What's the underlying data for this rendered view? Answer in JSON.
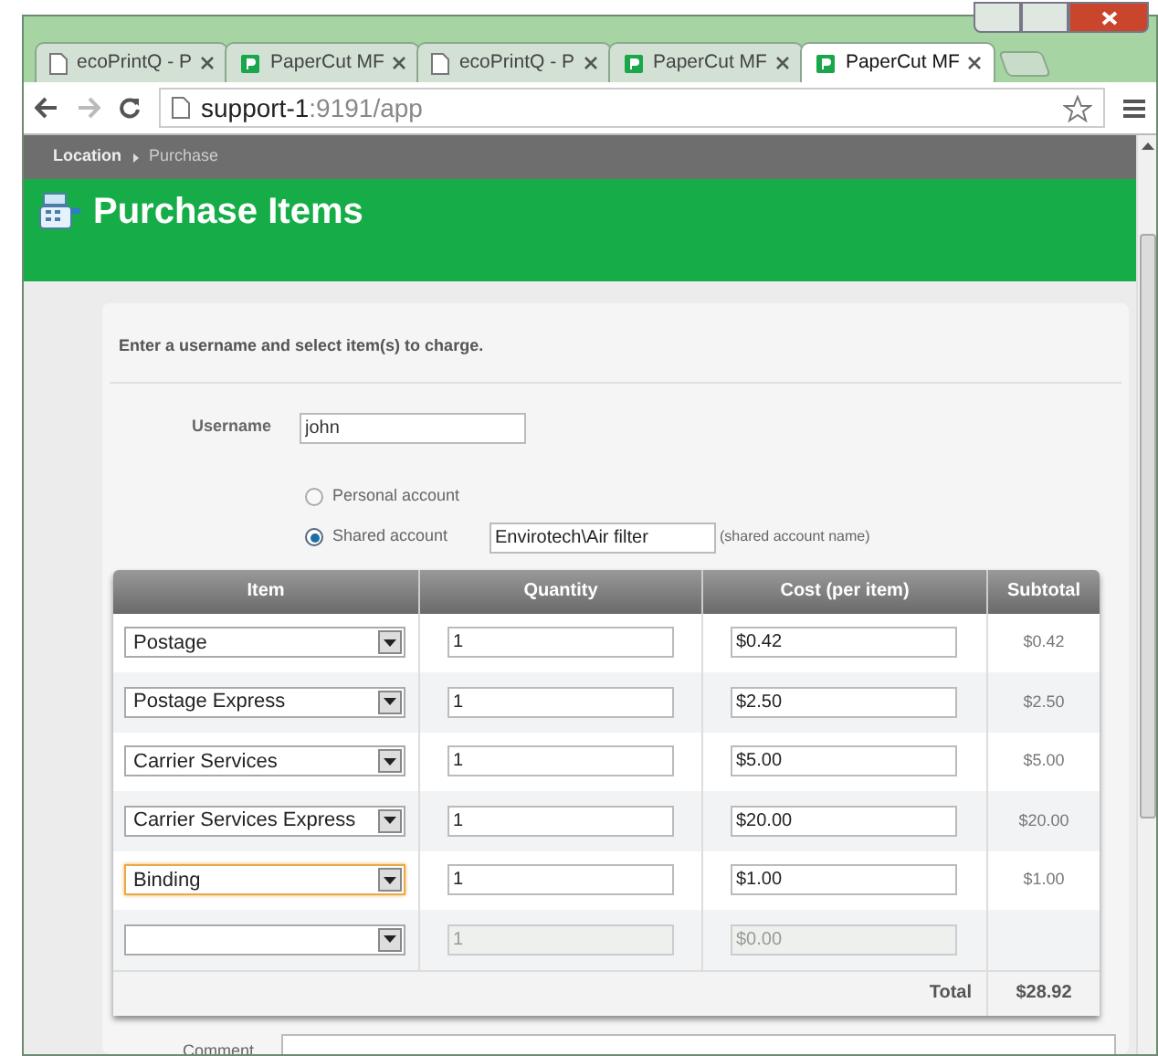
{
  "browser": {
    "tabs": [
      {
        "title": "ecoPrintQ - P",
        "kind": "page",
        "selected": false
      },
      {
        "title": "PaperCut MF",
        "kind": "papercut",
        "selected": false
      },
      {
        "title": "ecoPrintQ - P",
        "kind": "page",
        "selected": false
      },
      {
        "title": "PaperCut MF",
        "kind": "papercut",
        "selected": false
      },
      {
        "title": "PaperCut MF",
        "kind": "papercut",
        "selected": true
      }
    ],
    "address": {
      "host": "support-1",
      "rest": ":9191/app"
    }
  },
  "breadcrumb": {
    "items": [
      "Location",
      "Purchase"
    ]
  },
  "header": {
    "title": "Purchase Items"
  },
  "form": {
    "instructions": "Enter a username and select item(s) to charge.",
    "username": {
      "label": "Username",
      "value": "john"
    },
    "accounts": [
      {
        "label": "Personal account",
        "selected": false
      },
      {
        "label": "Shared account",
        "selected": true,
        "value": "Envirotech\\Air filter",
        "hint": "(shared account name)"
      }
    ],
    "table": {
      "columns": [
        "Item",
        "Quantity",
        "Cost (per item)",
        "Subtotal"
      ],
      "rows": [
        {
          "item": "Postage",
          "quantity": "1",
          "cost": "$0.42",
          "subtotal": "$0.42",
          "focused": false,
          "disabled": false
        },
        {
          "item": "Postage Express",
          "quantity": "1",
          "cost": "$2.50",
          "subtotal": "$2.50",
          "focused": false,
          "disabled": false
        },
        {
          "item": "Carrier Services",
          "quantity": "1",
          "cost": "$5.00",
          "subtotal": "$5.00",
          "focused": false,
          "disabled": false
        },
        {
          "item": "Carrier Services Express",
          "quantity": "1",
          "cost": "$20.00",
          "subtotal": "$20.00",
          "focused": false,
          "disabled": false
        },
        {
          "item": "Binding",
          "quantity": "1",
          "cost": "$1.00",
          "subtotal": "$1.00",
          "focused": true,
          "disabled": false
        },
        {
          "quantity": "1",
          "cost": "$0.00",
          "focused": false,
          "disabled": true
        }
      ],
      "total_label": "Total",
      "total": "$28.92"
    },
    "comment": {
      "label": "Comment"
    }
  }
}
